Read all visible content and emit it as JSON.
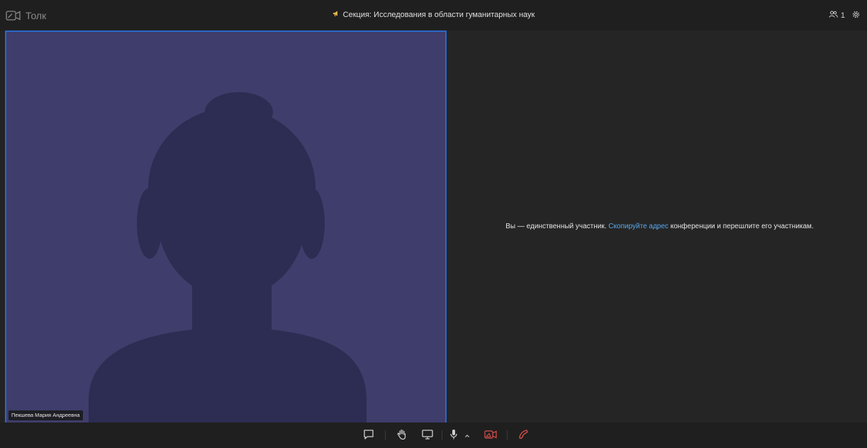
{
  "app": {
    "name": "Толк"
  },
  "header": {
    "title": "Секция: Исследования в области гуманитарных наук",
    "participant_count": "1"
  },
  "video": {
    "participant_name": "Пекшева Мария Андреевна",
    "tile_color": "#3f3d6b",
    "silhouette_color": "#2d2c52",
    "active_border_color": "#2c67c9"
  },
  "message": {
    "before": "Вы — единственный участник. ",
    "link": "Скопируйте адрес",
    "after": " конференции и перешлите его участникам."
  },
  "toolbar": {
    "buttons": [
      "chat-icon",
      "raise-hand-icon",
      "screen-share-icon",
      "microphone-icon",
      "chevron-up-icon",
      "camera-off-icon",
      "hang-up-icon"
    ]
  },
  "colors": {
    "link": "#5aa9f0",
    "danger": "#e0504a",
    "background": "#232323"
  }
}
